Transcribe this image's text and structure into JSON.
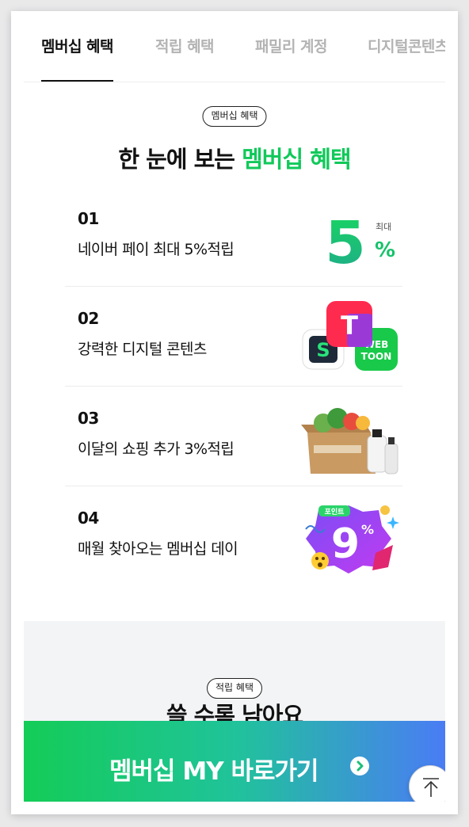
{
  "tabs": [
    {
      "label": "멤버십 혜택",
      "active": true
    },
    {
      "label": "적립 혜택",
      "active": false
    },
    {
      "label": "패밀리 계정",
      "active": false
    },
    {
      "label": "디지털콘텐츠",
      "active": false
    }
  ],
  "section1": {
    "pill": "멤버십 혜택",
    "headline_pre": "한 눈에 보는 ",
    "headline_highlight": "멤버십 혜택",
    "benefits": [
      {
        "num": "01",
        "label": "네이버 페이 최대 5%적립",
        "art": "five-percent-icon",
        "art_text": {
          "big": "5",
          "small": "최대",
          "pct": "%"
        }
      },
      {
        "num": "02",
        "label": "강력한 디지털 콘텐츠",
        "art": "digital-content-apps-icon",
        "art_text": {
          "t": "T",
          "s": "S",
          "webtoon1": "WEB",
          "webtoon2": "TOON"
        }
      },
      {
        "num": "03",
        "label": "이달의 쇼핑 추가 3%적립",
        "art": "shopping-box-icon"
      },
      {
        "num": "04",
        "label": "매월 찾아오는 멤버십 데이",
        "art": "membership-day-badge-icon",
        "art_text": {
          "badge": "9",
          "pct": "%",
          "point": "포인트"
        }
      }
    ]
  },
  "section2": {
    "pill": "적립 혜택",
    "headline": "쓸 수록 남아요"
  },
  "cta": {
    "label": "멤버십 MY 바로가기"
  },
  "colors": {
    "accent_green": "#10c95a",
    "cta_start": "#14cc57",
    "cta_end": "#4a7cf5"
  }
}
